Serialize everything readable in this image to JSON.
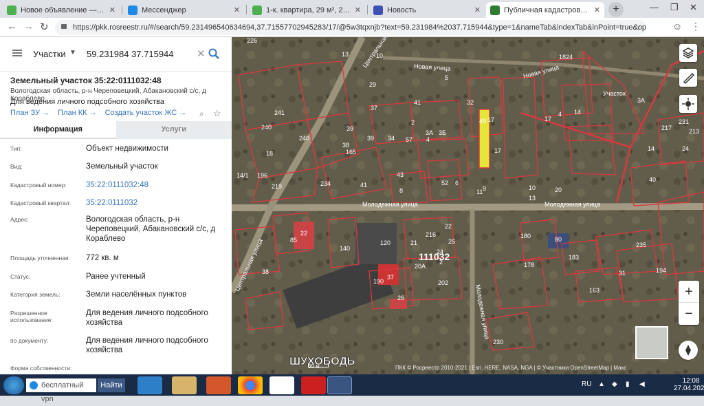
{
  "browser": {
    "tabs": [
      {
        "title": "Новое объявление — Объяв",
        "favicon_color": "#4caf50"
      },
      {
        "title": "Мессенджер",
        "favicon_color": "#1e88e5"
      },
      {
        "title": "1-к. квартира, 29 м², 2/5 эт. в",
        "favicon_color": "#4caf50"
      },
      {
        "title": "Новость",
        "favicon_color": "#3f51b5"
      },
      {
        "title": "Публичная кадастровая карта",
        "favicon_color": "#2e7d32"
      }
    ],
    "new_tab": "+",
    "url": "https://pkk.rosreestr.ru/#/search/59.231496540634694,37.71557702945283/17/@5w3tqxnjb?text=59.231984%2037.715944&type=1&nameTab&indexTab&inPoint=true&opened..."
  },
  "search": {
    "category": "Участки",
    "query": "59.231984 37.715944"
  },
  "parcel": {
    "title": "Земельный участок 35:22:0111032:48",
    "address_short": "Вологодская область, р-н Череповецкий, Абакановский с/с, д Кораблево",
    "usage": "Для ведения личного подсобного хозяйства",
    "links": [
      "План ЗУ →",
      "План КК →",
      "Создать участок ЖС →"
    ]
  },
  "info_tabs": {
    "info": "Информация",
    "services": "Услуги"
  },
  "fields": [
    {
      "label": "Тип:",
      "value": "Объект недвижимости",
      "link": false
    },
    {
      "label": "Вид:",
      "value": "Земельный участок",
      "link": false
    },
    {
      "label": "Кадастровый номер:",
      "value": "35:22:0111032:48",
      "link": true
    },
    {
      "label": "Кадастровый квартал:",
      "value": "35:22:0111032",
      "link": true
    },
    {
      "label": "Адрес:",
      "value": "Вологодская область, р-н Череповецкий, Абакановский с/с, д Кораблево",
      "link": false
    },
    {
      "label": "Площадь уточненная:",
      "value": "772 кв. м",
      "link": false
    },
    {
      "label": "Статус:",
      "value": "Ранее учтенный",
      "link": false
    },
    {
      "label": "Категория земель:",
      "value": "Земли населённых пунктов",
      "link": false
    },
    {
      "label": "Разрешенное использование:",
      "value": "Для ведения личного подсобного хозяйства",
      "link": false
    },
    {
      "label": "по документу:",
      "value": "Для ведения личного подсобного хозяйства",
      "link": false
    },
    {
      "label": "Форма собственности:",
      "value": "",
      "link": false
    }
  ],
  "map": {
    "streets": [
      "Новая улица",
      "Новая улица",
      "Молодежная улица",
      "Молодежная улица",
      "Центральная улица",
      "Центральная",
      "Молодежная улица"
    ],
    "plot_numbers": [
      "226",
      "13",
      "10",
      "29",
      "1824",
      "Участок",
      "41",
      "32",
      "5",
      "37",
      "2",
      "3А",
      "3Б",
      "57",
      "4",
      "4",
      "241",
      "240",
      "39",
      "240",
      "34",
      "39",
      "38",
      "165",
      "17",
      "17",
      "18",
      "14/1",
      "196",
      "219",
      "234",
      "41",
      "43",
      "8",
      "52",
      "6",
      "9",
      "10",
      "20",
      "85",
      "22",
      "140",
      "120",
      "22",
      "216",
      "21",
      "24",
      "11",
      "13",
      "180",
      "80",
      "183",
      "178",
      "235",
      "31",
      "194",
      "38",
      "190",
      "37",
      "202",
      "20А",
      "163",
      "26",
      "230",
      "2",
      "25",
      "48",
      "14",
      "17",
      "3А",
      "36",
      "217",
      "231",
      "213",
      "24",
      "14",
      "40"
    ],
    "quarter_label": "111032",
    "place_name": "ШУХОБОДЬ",
    "scale": "60 м",
    "attribution": "ПКК © Росреестр 2010-2021 | Esri, HERE, NASA, NGA | © Участники OpenStreetMap | Макс"
  },
  "taskbar": {
    "vpn_placeholder": "бесплатный vpn",
    "go": "Найти",
    "lang": "RU",
    "time": "12:08",
    "date": "27.04.2021"
  }
}
